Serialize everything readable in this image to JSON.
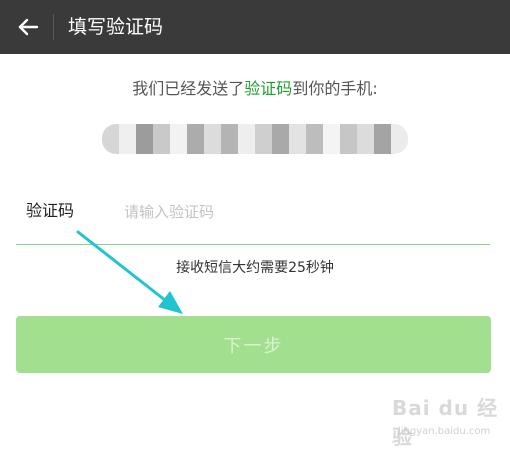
{
  "header": {
    "title": "填写验证码",
    "back_icon": "arrow-left-icon"
  },
  "message": {
    "prefix": "我们已经发送了",
    "highlight": "验证码",
    "suffix": "到你的手机:"
  },
  "phone_number": {
    "state": "pixelated / obscured",
    "mosaic_colors": [
      "#d6d6d6",
      "#efefef",
      "#9c9c9c",
      "#c9c9c9",
      "#f2f2f2",
      "#acacac",
      "#dcdcdc",
      "#b4b4b4",
      "#eeeeee",
      "#cfcfcf",
      "#a9a9a9",
      "#e3e3e3",
      "#bdbdbd",
      "#f4f4f4",
      "#c6c6c6",
      "#dcdcdc",
      "#a4a4a4",
      "#ececec"
    ]
  },
  "form": {
    "label": "验证码",
    "placeholder": "请输入验证码",
    "value": ""
  },
  "hint": "接收短信大约需要25秒钟",
  "next_button": {
    "label": "下一步",
    "state": "disabled"
  },
  "colors": {
    "header_bg": "#3a3a3a",
    "highlight": "#1f9e2e",
    "button_bg": "#a2df8f",
    "underline": "#8bd08b",
    "annotation_arrow": "#20c4d0"
  },
  "watermark": {
    "brand": "Bai du 经验",
    "url": "jingyan.baidu.com"
  }
}
